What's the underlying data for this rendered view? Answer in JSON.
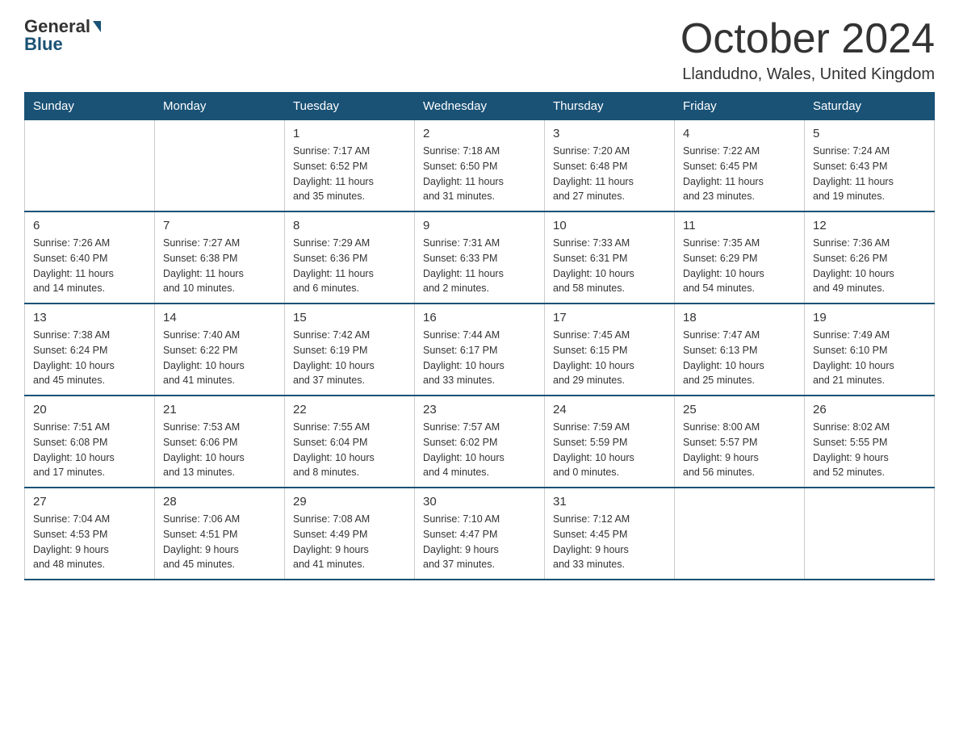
{
  "header": {
    "logo_general": "General",
    "logo_blue": "Blue",
    "month_title": "October 2024",
    "location": "Llandudno, Wales, United Kingdom"
  },
  "days_of_week": [
    "Sunday",
    "Monday",
    "Tuesday",
    "Wednesday",
    "Thursday",
    "Friday",
    "Saturday"
  ],
  "weeks": [
    [
      {
        "day": "",
        "info": ""
      },
      {
        "day": "",
        "info": ""
      },
      {
        "day": "1",
        "info": "Sunrise: 7:17 AM\nSunset: 6:52 PM\nDaylight: 11 hours\nand 35 minutes."
      },
      {
        "day": "2",
        "info": "Sunrise: 7:18 AM\nSunset: 6:50 PM\nDaylight: 11 hours\nand 31 minutes."
      },
      {
        "day": "3",
        "info": "Sunrise: 7:20 AM\nSunset: 6:48 PM\nDaylight: 11 hours\nand 27 minutes."
      },
      {
        "day": "4",
        "info": "Sunrise: 7:22 AM\nSunset: 6:45 PM\nDaylight: 11 hours\nand 23 minutes."
      },
      {
        "day": "5",
        "info": "Sunrise: 7:24 AM\nSunset: 6:43 PM\nDaylight: 11 hours\nand 19 minutes."
      }
    ],
    [
      {
        "day": "6",
        "info": "Sunrise: 7:26 AM\nSunset: 6:40 PM\nDaylight: 11 hours\nand 14 minutes."
      },
      {
        "day": "7",
        "info": "Sunrise: 7:27 AM\nSunset: 6:38 PM\nDaylight: 11 hours\nand 10 minutes."
      },
      {
        "day": "8",
        "info": "Sunrise: 7:29 AM\nSunset: 6:36 PM\nDaylight: 11 hours\nand 6 minutes."
      },
      {
        "day": "9",
        "info": "Sunrise: 7:31 AM\nSunset: 6:33 PM\nDaylight: 11 hours\nand 2 minutes."
      },
      {
        "day": "10",
        "info": "Sunrise: 7:33 AM\nSunset: 6:31 PM\nDaylight: 10 hours\nand 58 minutes."
      },
      {
        "day": "11",
        "info": "Sunrise: 7:35 AM\nSunset: 6:29 PM\nDaylight: 10 hours\nand 54 minutes."
      },
      {
        "day": "12",
        "info": "Sunrise: 7:36 AM\nSunset: 6:26 PM\nDaylight: 10 hours\nand 49 minutes."
      }
    ],
    [
      {
        "day": "13",
        "info": "Sunrise: 7:38 AM\nSunset: 6:24 PM\nDaylight: 10 hours\nand 45 minutes."
      },
      {
        "day": "14",
        "info": "Sunrise: 7:40 AM\nSunset: 6:22 PM\nDaylight: 10 hours\nand 41 minutes."
      },
      {
        "day": "15",
        "info": "Sunrise: 7:42 AM\nSunset: 6:19 PM\nDaylight: 10 hours\nand 37 minutes."
      },
      {
        "day": "16",
        "info": "Sunrise: 7:44 AM\nSunset: 6:17 PM\nDaylight: 10 hours\nand 33 minutes."
      },
      {
        "day": "17",
        "info": "Sunrise: 7:45 AM\nSunset: 6:15 PM\nDaylight: 10 hours\nand 29 minutes."
      },
      {
        "day": "18",
        "info": "Sunrise: 7:47 AM\nSunset: 6:13 PM\nDaylight: 10 hours\nand 25 minutes."
      },
      {
        "day": "19",
        "info": "Sunrise: 7:49 AM\nSunset: 6:10 PM\nDaylight: 10 hours\nand 21 minutes."
      }
    ],
    [
      {
        "day": "20",
        "info": "Sunrise: 7:51 AM\nSunset: 6:08 PM\nDaylight: 10 hours\nand 17 minutes."
      },
      {
        "day": "21",
        "info": "Sunrise: 7:53 AM\nSunset: 6:06 PM\nDaylight: 10 hours\nand 13 minutes."
      },
      {
        "day": "22",
        "info": "Sunrise: 7:55 AM\nSunset: 6:04 PM\nDaylight: 10 hours\nand 8 minutes."
      },
      {
        "day": "23",
        "info": "Sunrise: 7:57 AM\nSunset: 6:02 PM\nDaylight: 10 hours\nand 4 minutes."
      },
      {
        "day": "24",
        "info": "Sunrise: 7:59 AM\nSunset: 5:59 PM\nDaylight: 10 hours\nand 0 minutes."
      },
      {
        "day": "25",
        "info": "Sunrise: 8:00 AM\nSunset: 5:57 PM\nDaylight: 9 hours\nand 56 minutes."
      },
      {
        "day": "26",
        "info": "Sunrise: 8:02 AM\nSunset: 5:55 PM\nDaylight: 9 hours\nand 52 minutes."
      }
    ],
    [
      {
        "day": "27",
        "info": "Sunrise: 7:04 AM\nSunset: 4:53 PM\nDaylight: 9 hours\nand 48 minutes."
      },
      {
        "day": "28",
        "info": "Sunrise: 7:06 AM\nSunset: 4:51 PM\nDaylight: 9 hours\nand 45 minutes."
      },
      {
        "day": "29",
        "info": "Sunrise: 7:08 AM\nSunset: 4:49 PM\nDaylight: 9 hours\nand 41 minutes."
      },
      {
        "day": "30",
        "info": "Sunrise: 7:10 AM\nSunset: 4:47 PM\nDaylight: 9 hours\nand 37 minutes."
      },
      {
        "day": "31",
        "info": "Sunrise: 7:12 AM\nSunset: 4:45 PM\nDaylight: 9 hours\nand 33 minutes."
      },
      {
        "day": "",
        "info": ""
      },
      {
        "day": "",
        "info": ""
      }
    ]
  ]
}
